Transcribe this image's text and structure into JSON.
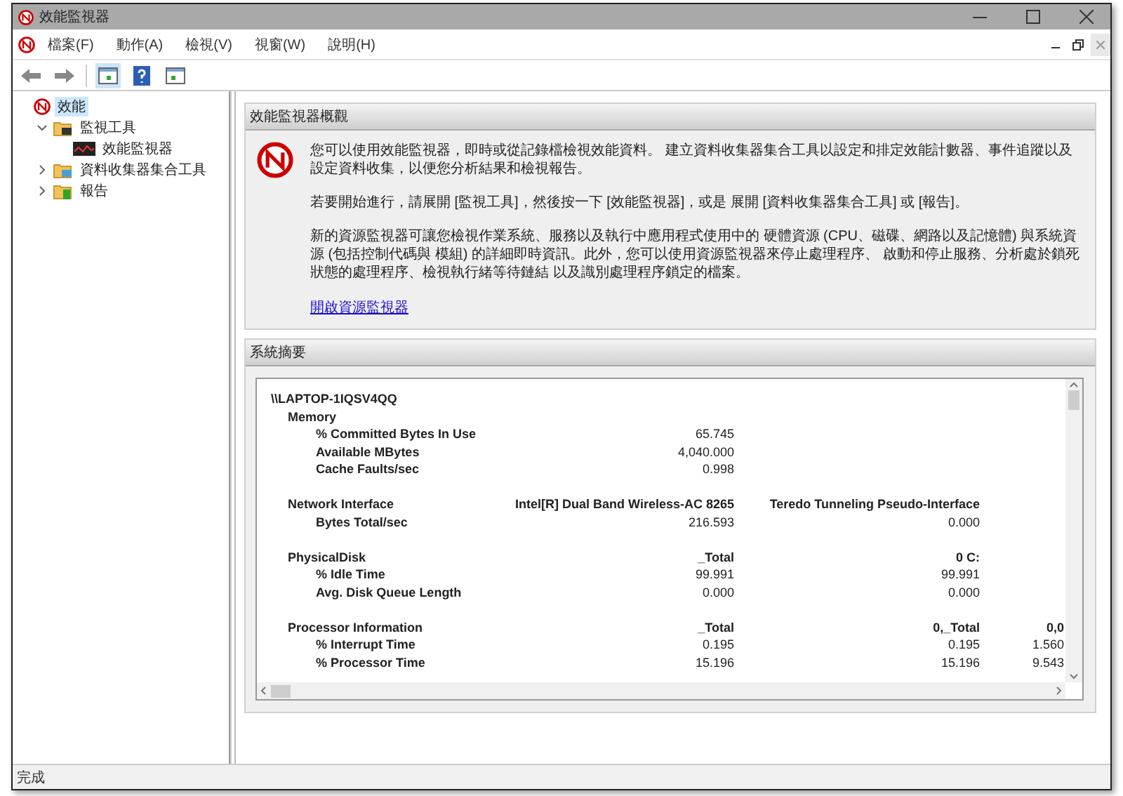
{
  "window": {
    "title": "效能監視器"
  },
  "menu": [
    "檔案(F)",
    "動作(A)",
    "檢視(V)",
    "視窗(W)",
    "說明(H)"
  ],
  "tree": [
    {
      "label": "效能",
      "kind": "root",
      "selected": true,
      "children": [
        {
          "label": "監視工具",
          "kind": "tools",
          "selected": false,
          "expanded": true,
          "children": [
            {
              "label": "效能監視器",
              "kind": "monitor",
              "selected": false
            }
          ]
        },
        {
          "label": "資料收集器集合工具",
          "kind": "collector",
          "selected": false,
          "expanded": false
        },
        {
          "label": "報告",
          "kind": "reports",
          "selected": false,
          "expanded": false
        }
      ]
    }
  ],
  "overview": {
    "title": "效能監視器概觀",
    "paragraphs": [
      "您可以使用效能監視器，即時或從記錄檔檢視效能資料。 建立資料收集器集合工具以設定和排定效能計數器、事件追蹤以及設定資料收集，以便您分析結果和檢視報告。",
      "若要開始進行，請展開 [監視工具]，然後按一下 [效能監視器]，或是 展開 [資料收集器集合工具] 或 [報告]。",
      "新的資源監視器可讓您檢視作業系統、服務以及執行中應用程式使用中的 硬體資源 (CPU、磁碟、網路以及記憶體) 與系統資源 (包括控制代碼與 模組) 的詳細即時資訊。此外，您可以使用資源監視器來停止處理程序、 啟動和停止服務、分析處於鎖死狀態的處理程序、檢視執行緒等待鏈結 以及識別處理程序鎖定的檔案。"
    ],
    "link": "開啟資源監視器"
  },
  "summary": {
    "title": "系統摘要",
    "host": "\\\\LAPTOP-1IQSV4QQ",
    "sections": [
      {
        "name": "Memory",
        "counters": [
          {
            "name": "% Committed Bytes In Use",
            "values": [
              "65.745"
            ]
          },
          {
            "name": "Available MBytes",
            "values": [
              "4,040.000"
            ]
          },
          {
            "name": "Cache Faults/sec",
            "values": [
              "0.998"
            ]
          }
        ]
      },
      {
        "name": "Network Interface",
        "columns": [
          "Intel[R] Dual Band Wireless-AC 8265",
          "Teredo Tunneling Pseudo-Interface"
        ],
        "counters": [
          {
            "name": "Bytes Total/sec",
            "values": [
              "216.593",
              "0.000"
            ]
          }
        ]
      },
      {
        "name": "PhysicalDisk",
        "columns": [
          "_Total",
          "0 C:"
        ],
        "counters": [
          {
            "name": "% Idle Time",
            "values": [
              "99.991",
              "99.991"
            ]
          },
          {
            "name": "Avg. Disk Queue Length",
            "values": [
              "0.000",
              "0.000"
            ]
          }
        ]
      },
      {
        "name": "Processor Information",
        "columns": [
          "_Total",
          "0,_Total",
          "0,0"
        ],
        "counters": [
          {
            "name": "% Interrupt Time",
            "values": [
              "0.195",
              "0.195",
              "1.560"
            ]
          },
          {
            "name": "% Processor Time",
            "values": [
              "15.196",
              "15.196",
              "9.543"
            ]
          }
        ]
      }
    ]
  },
  "status_bar": "完成"
}
